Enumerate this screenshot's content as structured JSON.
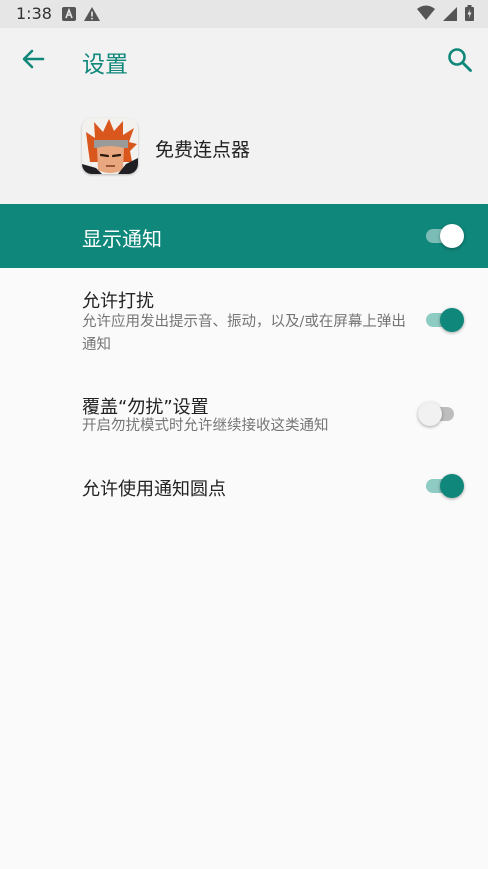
{
  "status_bar": {
    "time": "1:38",
    "left_icons": [
      "notification-a-icon",
      "warning-icon"
    ],
    "right_icons": [
      "wifi-icon",
      "signal-icon",
      "battery-icon"
    ]
  },
  "app_bar": {
    "title": "设置",
    "back_icon": "arrow-left-icon",
    "search_icon": "search-icon"
  },
  "app_header": {
    "app_name": "免费连点器"
  },
  "master_toggle": {
    "label": "显示通知",
    "enabled": true
  },
  "settings": [
    {
      "title": "允许打扰",
      "summary": "允许应用发出提示音、振动，以及/或在屏幕上弹出通知",
      "enabled": true
    },
    {
      "title": "覆盖“勿扰”设置",
      "summary": "开启勿扰模式时允许继续接收这类通知",
      "enabled": false
    },
    {
      "title": "允许使用通知圆点",
      "summary": "",
      "enabled": true
    }
  ],
  "colors": {
    "accent": "#0f877a",
    "background": "#fafafa",
    "header_background": "#f2f2f2"
  }
}
